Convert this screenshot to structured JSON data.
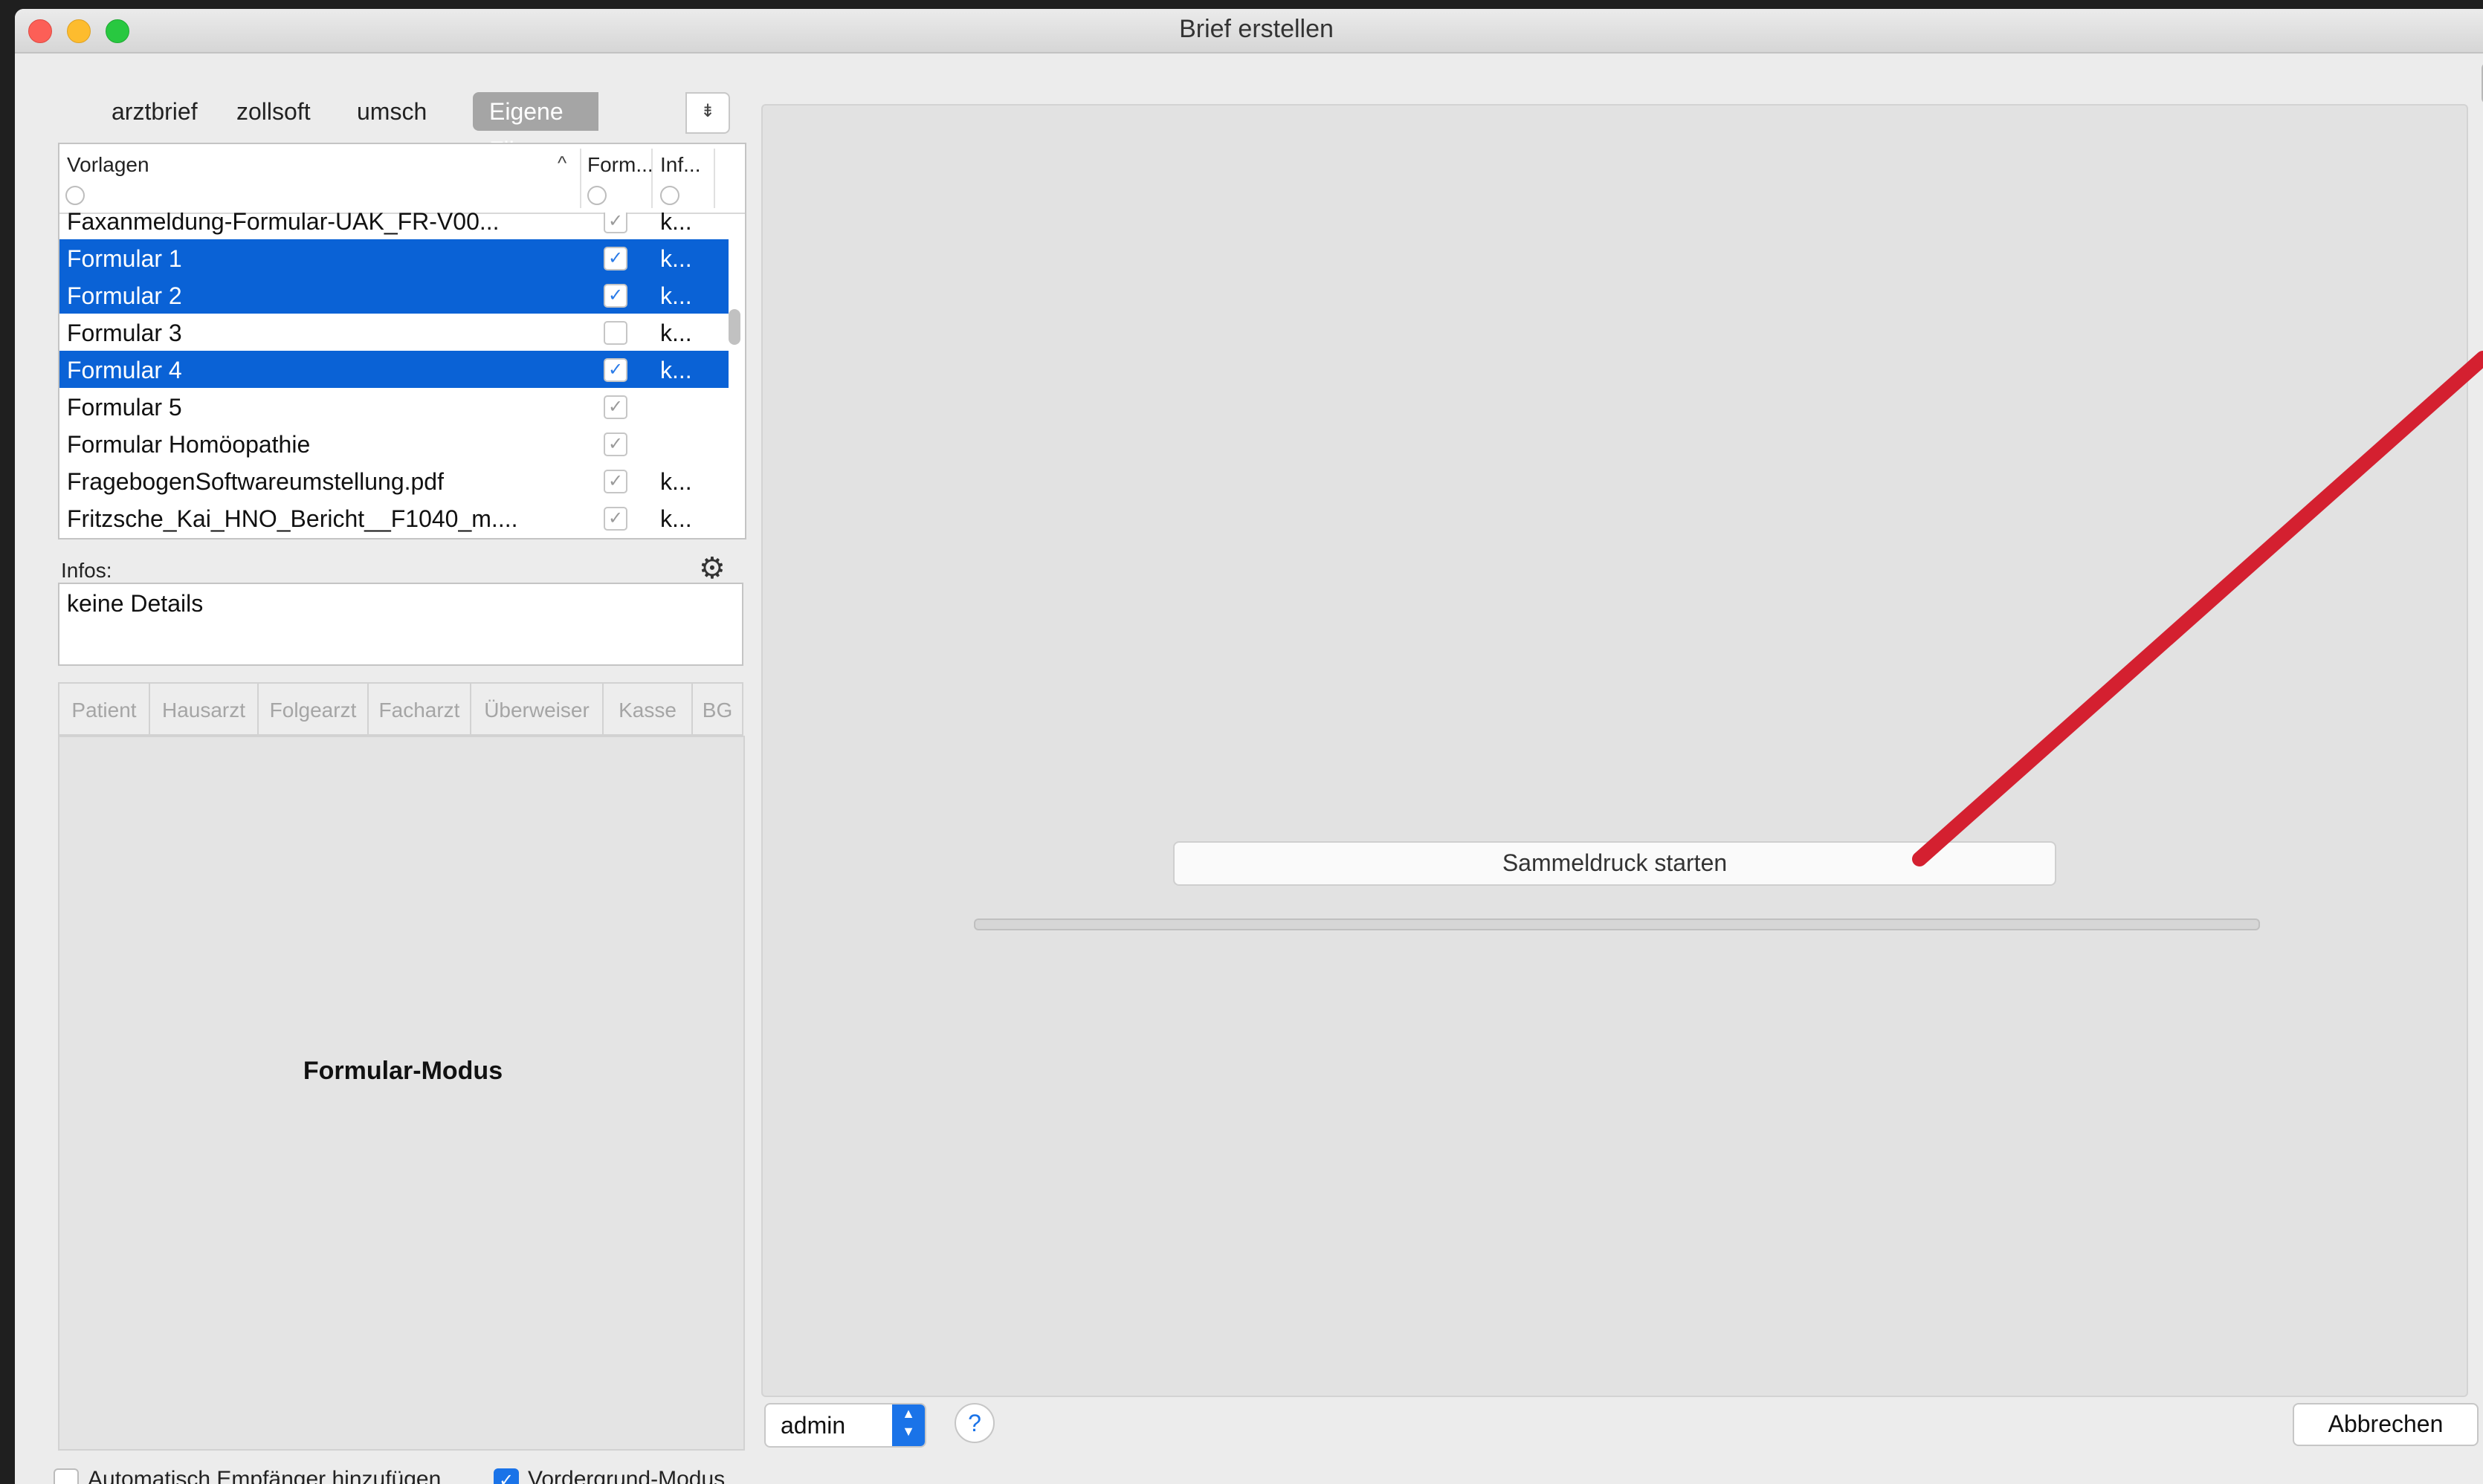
{
  "window": {
    "title": "Brief erstellen"
  },
  "filter_tabs": [
    {
      "label": "arztbrief"
    },
    {
      "label": "zollsoft"
    },
    {
      "label": "umsch"
    },
    {
      "label": "Eigene Filterung"
    }
  ],
  "filter_dropdown_icon": "⇟",
  "table": {
    "columns": {
      "name": "Vorlagen",
      "form": "Form...",
      "info": "Inf..."
    },
    "rows": [
      {
        "name": "Faxanmeldung-Formular-UAK_FR-V00...",
        "checked": "✓",
        "info": "k...",
        "selected": false
      },
      {
        "name": "Formular 1",
        "checked": "✓",
        "info": "k...",
        "selected": true
      },
      {
        "name": "Formular 2",
        "checked": "✓",
        "info": "k...",
        "selected": true
      },
      {
        "name": "Formular 3",
        "checked": "",
        "info": "k...",
        "selected": false
      },
      {
        "name": "Formular 4",
        "checked": "✓",
        "info": "k...",
        "selected": true
      },
      {
        "name": "Formular 5",
        "checked": "✓",
        "info": "",
        "selected": false
      },
      {
        "name": "Formular Homöopathie",
        "checked": "✓",
        "info": "",
        "selected": false
      },
      {
        "name": "FragebogenSoftwareumstellung.pdf",
        "checked": "✓",
        "info": "k...",
        "selected": false
      },
      {
        "name": "Fritzsche_Kai_HNO_Bericht__F1040_m....",
        "checked": "✓",
        "info": "k...",
        "selected": false
      }
    ]
  },
  "infos": {
    "label": "Infos:",
    "text": "keine Details"
  },
  "recipient_tabs": [
    "Patient",
    "Hausarzt",
    "Folgearzt",
    "Facharzt",
    "Überweiser",
    "Kasse",
    "BG"
  ],
  "mode_label": "Formular-Modus",
  "main": {
    "start_button": "Sammeldruck starten",
    "progress": 0
  },
  "bottom": {
    "user_value": "admin",
    "help_label": "?",
    "cancel_button": "Abbrechen",
    "auto_add": {
      "label": "Automatisch Empfänger hinzufügen",
      "checked": false
    },
    "foreground": {
      "label": "Vordergrund-Modus",
      "checked": true
    }
  },
  "colors": {
    "selection": "#0a62d6",
    "accent": "#1a73e8",
    "annotation_arrow": "#d42030"
  },
  "icons": {
    "settings": "gear-icon",
    "sort": "sort-ascending-icon",
    "help": "help-icon"
  }
}
